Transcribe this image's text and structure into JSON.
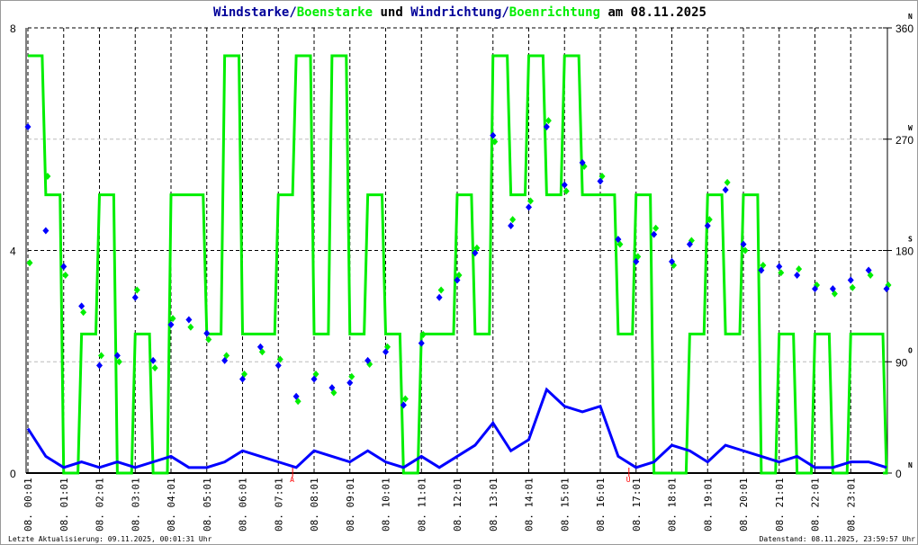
{
  "title": {
    "part1": "Windstarke",
    "sep1": "/",
    "part2": "Boenstarke",
    "mid": " und ",
    "part3": "Windrichtung",
    "sep2": "/",
    "part4": "Boenrichtung",
    "tail": " am 08.11.2025"
  },
  "footer": {
    "left": "Letzte Aktualisierung: 09.11.2025, 00:01:31 Uhr",
    "right": "Datenstand: 08.11.2025, 23:59:57 Uhr"
  },
  "colors": {
    "wind": "#0000ff",
    "gust": "#00ee00",
    "title_wind": "#000099",
    "marker": "#ff0000"
  },
  "chart_data": {
    "type": "line",
    "title": "Windstarke/Boenstarke und Windrichtung/Boenrichtung am 08.11.2025",
    "x_unit": "hours since 00:00",
    "x_step_hours": 0.5,
    "xlim": [
      0,
      24
    ],
    "x_tick_labels": [
      "08. 00:01",
      "08. 01:01",
      "08. 02:01",
      "08. 03:01",
      "08. 04:01",
      "08. 05:01",
      "08. 06:01",
      "08. 07:01",
      "08. 08:01",
      "08. 09:01",
      "08. 10:01",
      "08. 11:01",
      "08. 12:01",
      "08. 13:01",
      "08. 14:01",
      "08. 15:01",
      "08. 16:01",
      "08. 17:01",
      "08. 18:01",
      "08. 19:01",
      "08. 20:01",
      "08. 21:01",
      "08. 22:01",
      "08. 23:01"
    ],
    "left_axis": {
      "ylim": [
        0,
        8
      ],
      "ticks": [
        "0",
        "4",
        "8"
      ]
    },
    "right_axis": {
      "ylim": [
        0,
        360
      ],
      "ticks": [
        "0",
        "90",
        "180",
        "270",
        "360"
      ],
      "compass": [
        "N",
        "O",
        "S",
        "W",
        "N"
      ]
    },
    "markers": [
      {
        "label": "A",
        "hour": 7.4
      },
      {
        "label": "U",
        "hour": 16.8
      }
    ],
    "series": [
      {
        "name": "Windstarke",
        "axis": "left",
        "style": "line",
        "values": [
          0.8,
          0.3,
          0.1,
          0.2,
          0.1,
          0.2,
          0.1,
          0.2,
          0.3,
          0.1,
          0.1,
          0.2,
          0.4,
          0.3,
          0.2,
          0.1,
          0.4,
          0.3,
          0.2,
          0.4,
          0.2,
          0.1,
          0.3,
          0.1,
          0.3,
          0.5,
          0.9,
          0.4,
          0.6,
          1.5,
          1.2,
          1.1,
          1.2,
          0.3,
          0.1,
          0.2,
          0.5,
          0.4,
          0.2,
          0.5,
          0.4,
          0.3,
          0.2,
          0.3,
          0.1,
          0.1,
          0.2,
          0.2,
          0.1
        ]
      },
      {
        "name": "Boenstarke",
        "axis": "left",
        "style": "step",
        "values": [
          7.5,
          5,
          0,
          2.5,
          5,
          0,
          2.5,
          0,
          5,
          5,
          2.5,
          7.5,
          2.5,
          2.5,
          5,
          7.5,
          2.5,
          7.5,
          2.5,
          5,
          2.5,
          0,
          2.5,
          2.5,
          5,
          2.5,
          7.5,
          5,
          7.5,
          5,
          7.5,
          5,
          5,
          2.5,
          5,
          0,
          0,
          2.5,
          5,
          2.5,
          5,
          0,
          2.5,
          0,
          2.5,
          0,
          2.5,
          2.5,
          0
        ]
      },
      {
        "name": "Windrichtung",
        "axis": "right",
        "style": "points",
        "values": [
          280,
          196,
          167,
          135,
          87,
          95,
          142,
          91,
          120,
          124,
          113,
          91,
          76,
          102,
          87,
          62,
          76,
          69,
          73,
          91,
          98,
          55,
          105,
          142,
          156,
          178,
          273,
          200,
          215,
          280,
          233,
          251,
          236,
          189,
          171,
          193,
          171,
          185,
          200,
          229,
          185,
          164,
          167,
          160,
          149,
          149,
          156,
          164,
          149
        ]
      },
      {
        "name": "Boenrichtung",
        "axis": "right",
        "style": "points",
        "values": [
          170,
          240,
          160,
          130,
          95,
          90,
          148,
          85,
          125,
          118,
          108,
          95,
          80,
          98,
          92,
          58,
          80,
          65,
          78,
          88,
          102,
          60,
          112,
          148,
          160,
          182,
          268,
          205,
          220,
          285,
          228,
          248,
          240,
          185,
          175,
          198,
          168,
          188,
          205,
          235,
          180,
          168,
          162,
          165,
          152,
          145,
          150,
          160,
          152
        ]
      }
    ]
  }
}
